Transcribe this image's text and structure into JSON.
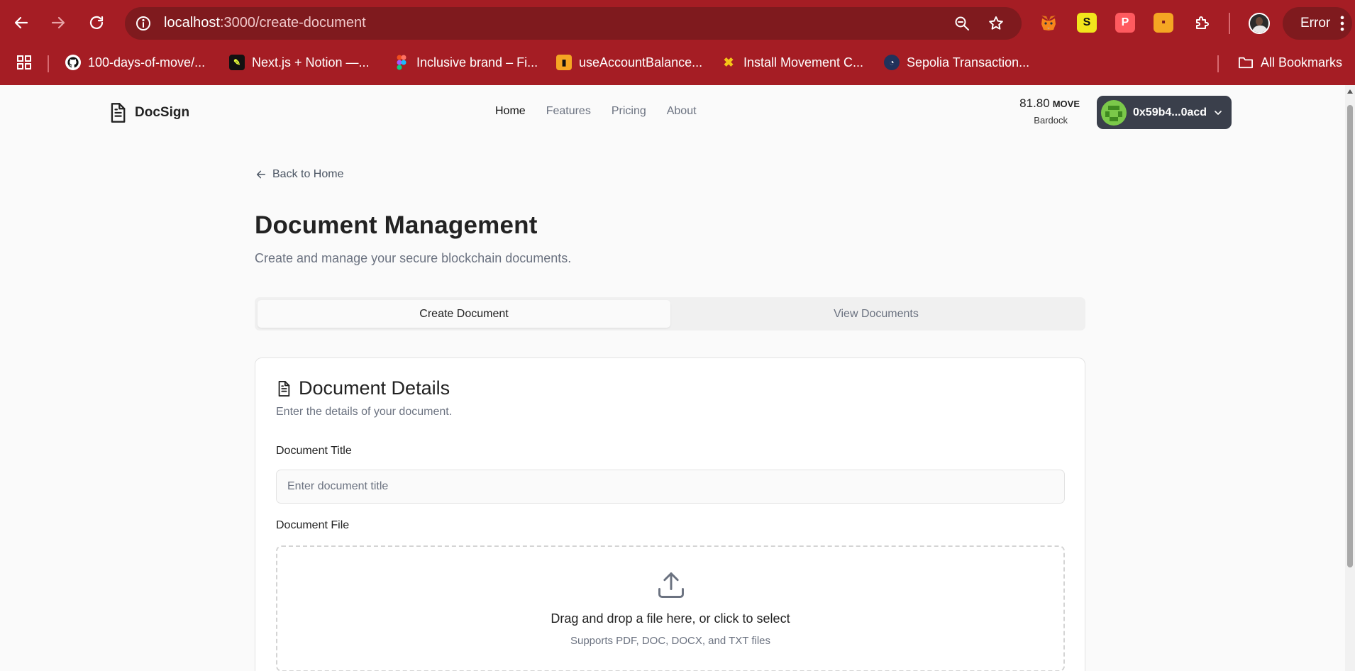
{
  "browser": {
    "url_host": "localhost",
    "url_path": ":3000/create-document",
    "error_label": "Error",
    "bookmarks": [
      {
        "label": "100-days-of-move/..."
      },
      {
        "label": "Next.js + Notion —..."
      },
      {
        "label": "Inclusive brand – Fi..."
      },
      {
        "label": "useAccountBalance..."
      },
      {
        "label": "Install Movement C..."
      },
      {
        "label": "Sepolia Transaction..."
      }
    ],
    "all_bookmarks_label": "All Bookmarks"
  },
  "header": {
    "brand": "DocSign",
    "nav": [
      {
        "label": "Home",
        "active": true
      },
      {
        "label": "Features",
        "active": false
      },
      {
        "label": "Pricing",
        "active": false
      },
      {
        "label": "About",
        "active": false
      }
    ],
    "balance": {
      "amount": "81.80",
      "unit": "MOVE",
      "network": "Bardock"
    },
    "wallet": {
      "address": "0x59b4...0acd"
    }
  },
  "main": {
    "back_label": "Back to Home",
    "title": "Document Management",
    "subtitle": "Create and manage your secure blockchain documents.",
    "tabs": [
      {
        "label": "Create Document",
        "active": true
      },
      {
        "label": "View Documents",
        "active": false
      }
    ],
    "card": {
      "title": "Document Details",
      "description": "Enter the details of your document.",
      "title_label": "Document Title",
      "title_value": "",
      "title_placeholder": "Enter document title",
      "file_label": "Document File",
      "drop_main": "Drag and drop a file here, or click to select",
      "drop_sub": "Supports PDF, DOC, DOCX, and TXT files"
    }
  },
  "colors": {
    "browser_frame": "#a51d24",
    "wallet_button": "#3a3f4b",
    "page_bg": "#fafafa"
  }
}
